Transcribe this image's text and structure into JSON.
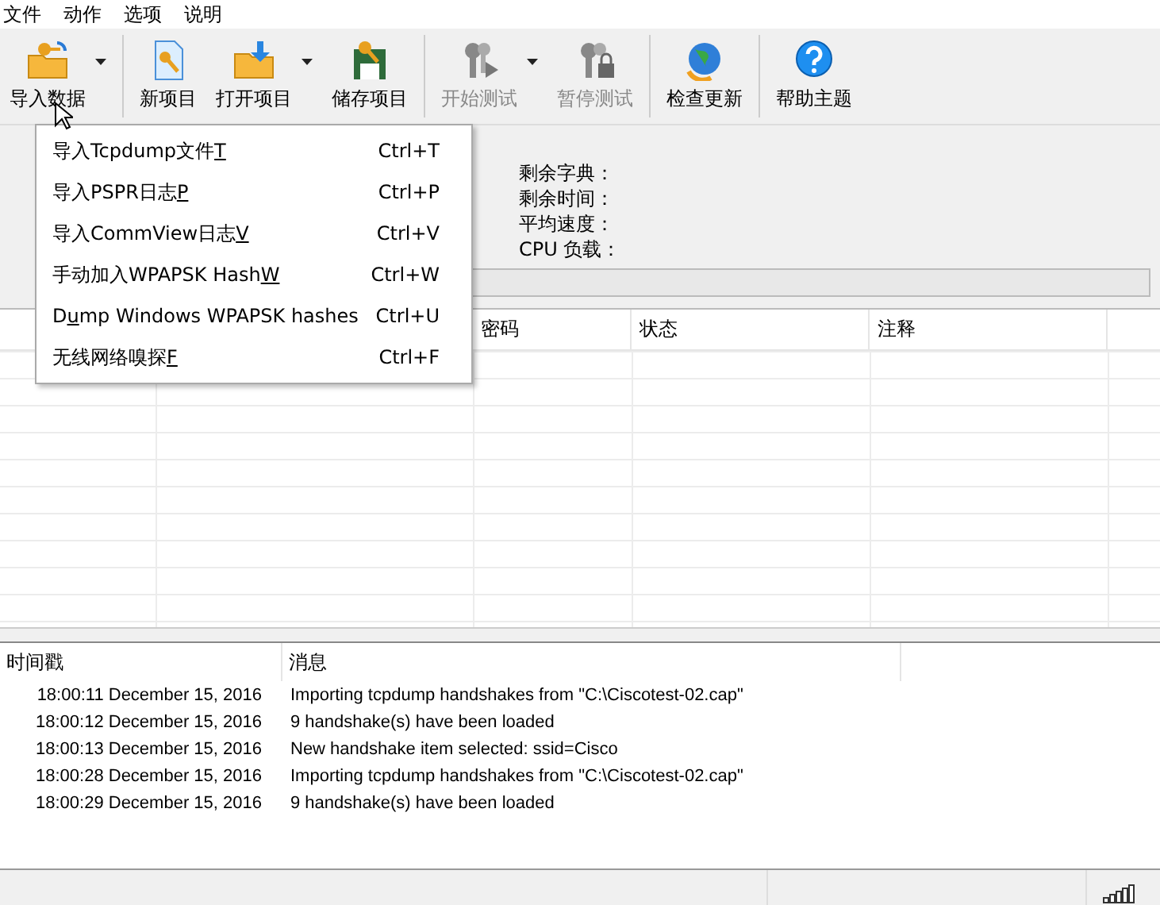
{
  "menu_bar": [
    "文件",
    "动作",
    "选项",
    "说明"
  ],
  "toolbar": [
    {
      "label": "导入数据",
      "dropdown": true,
      "disabled": false,
      "separator_after": true
    },
    {
      "label": "新项目",
      "dropdown": false,
      "disabled": false,
      "separator_after": false
    },
    {
      "label": "打开项目",
      "dropdown": true,
      "disabled": false,
      "separator_after": false
    },
    {
      "label": "储存项目",
      "dropdown": false,
      "disabled": false,
      "separator_after": true
    },
    {
      "label": "开始测试",
      "dropdown": true,
      "disabled": true,
      "separator_after": false
    },
    {
      "label": "暂停测试",
      "dropdown": false,
      "disabled": true,
      "separator_after": true
    },
    {
      "label": "检查更新",
      "dropdown": false,
      "disabled": false,
      "separator_after": true
    },
    {
      "label": "帮助主题",
      "dropdown": false,
      "disabled": false,
      "separator_after": false
    }
  ],
  "dropdown_menu": [
    {
      "before": "导入Tcpdump文件",
      "key": "T",
      "shortcut": "Ctrl+T"
    },
    {
      "before": "导入PSPR日志",
      "key": "P",
      "shortcut": "Ctrl+P"
    },
    {
      "before": "导入CommView日志",
      "key": "V",
      "shortcut": "Ctrl+V"
    },
    {
      "before": "手动加入WPAPSK Hash",
      "key": "W",
      "shortcut": "Ctrl+W"
    },
    {
      "before": "D",
      "key": "u",
      "after": "mp Windows WPAPSK hashes",
      "shortcut": "Ctrl+U"
    },
    {
      "before": "无线网络嗅探",
      "key": "F",
      "shortcut": "Ctrl+F"
    }
  ],
  "stats": [
    "剩余字典：",
    "剩余时间：",
    "平均速度：",
    "CPU 负载："
  ],
  "progress": {
    "level": 0
  },
  "table": {
    "columns": [
      "密码",
      "状态",
      "注释"
    ]
  },
  "log": {
    "columns": [
      "时间戳",
      "消息"
    ],
    "rows": [
      {
        "time": "18:00:11 December 15, 2016",
        "message": "Importing tcpdump handshakes from \"C:\\Ciscotest-02.cap\""
      },
      {
        "time": "18:00:12 December 15, 2016",
        "message": "9 handshake(s) have been loaded"
      },
      {
        "time": "18:00:13 December 15, 2016",
        "message": "New handshake item selected: ssid=Cisco"
      },
      {
        "time": "18:00:28 December 15, 2016",
        "message": "Importing tcpdump handshakes from \"C:\\Ciscotest-02.cap\""
      },
      {
        "time": "18:00:29 December 15, 2016",
        "message": "9 handshake(s) have been loaded"
      }
    ]
  }
}
